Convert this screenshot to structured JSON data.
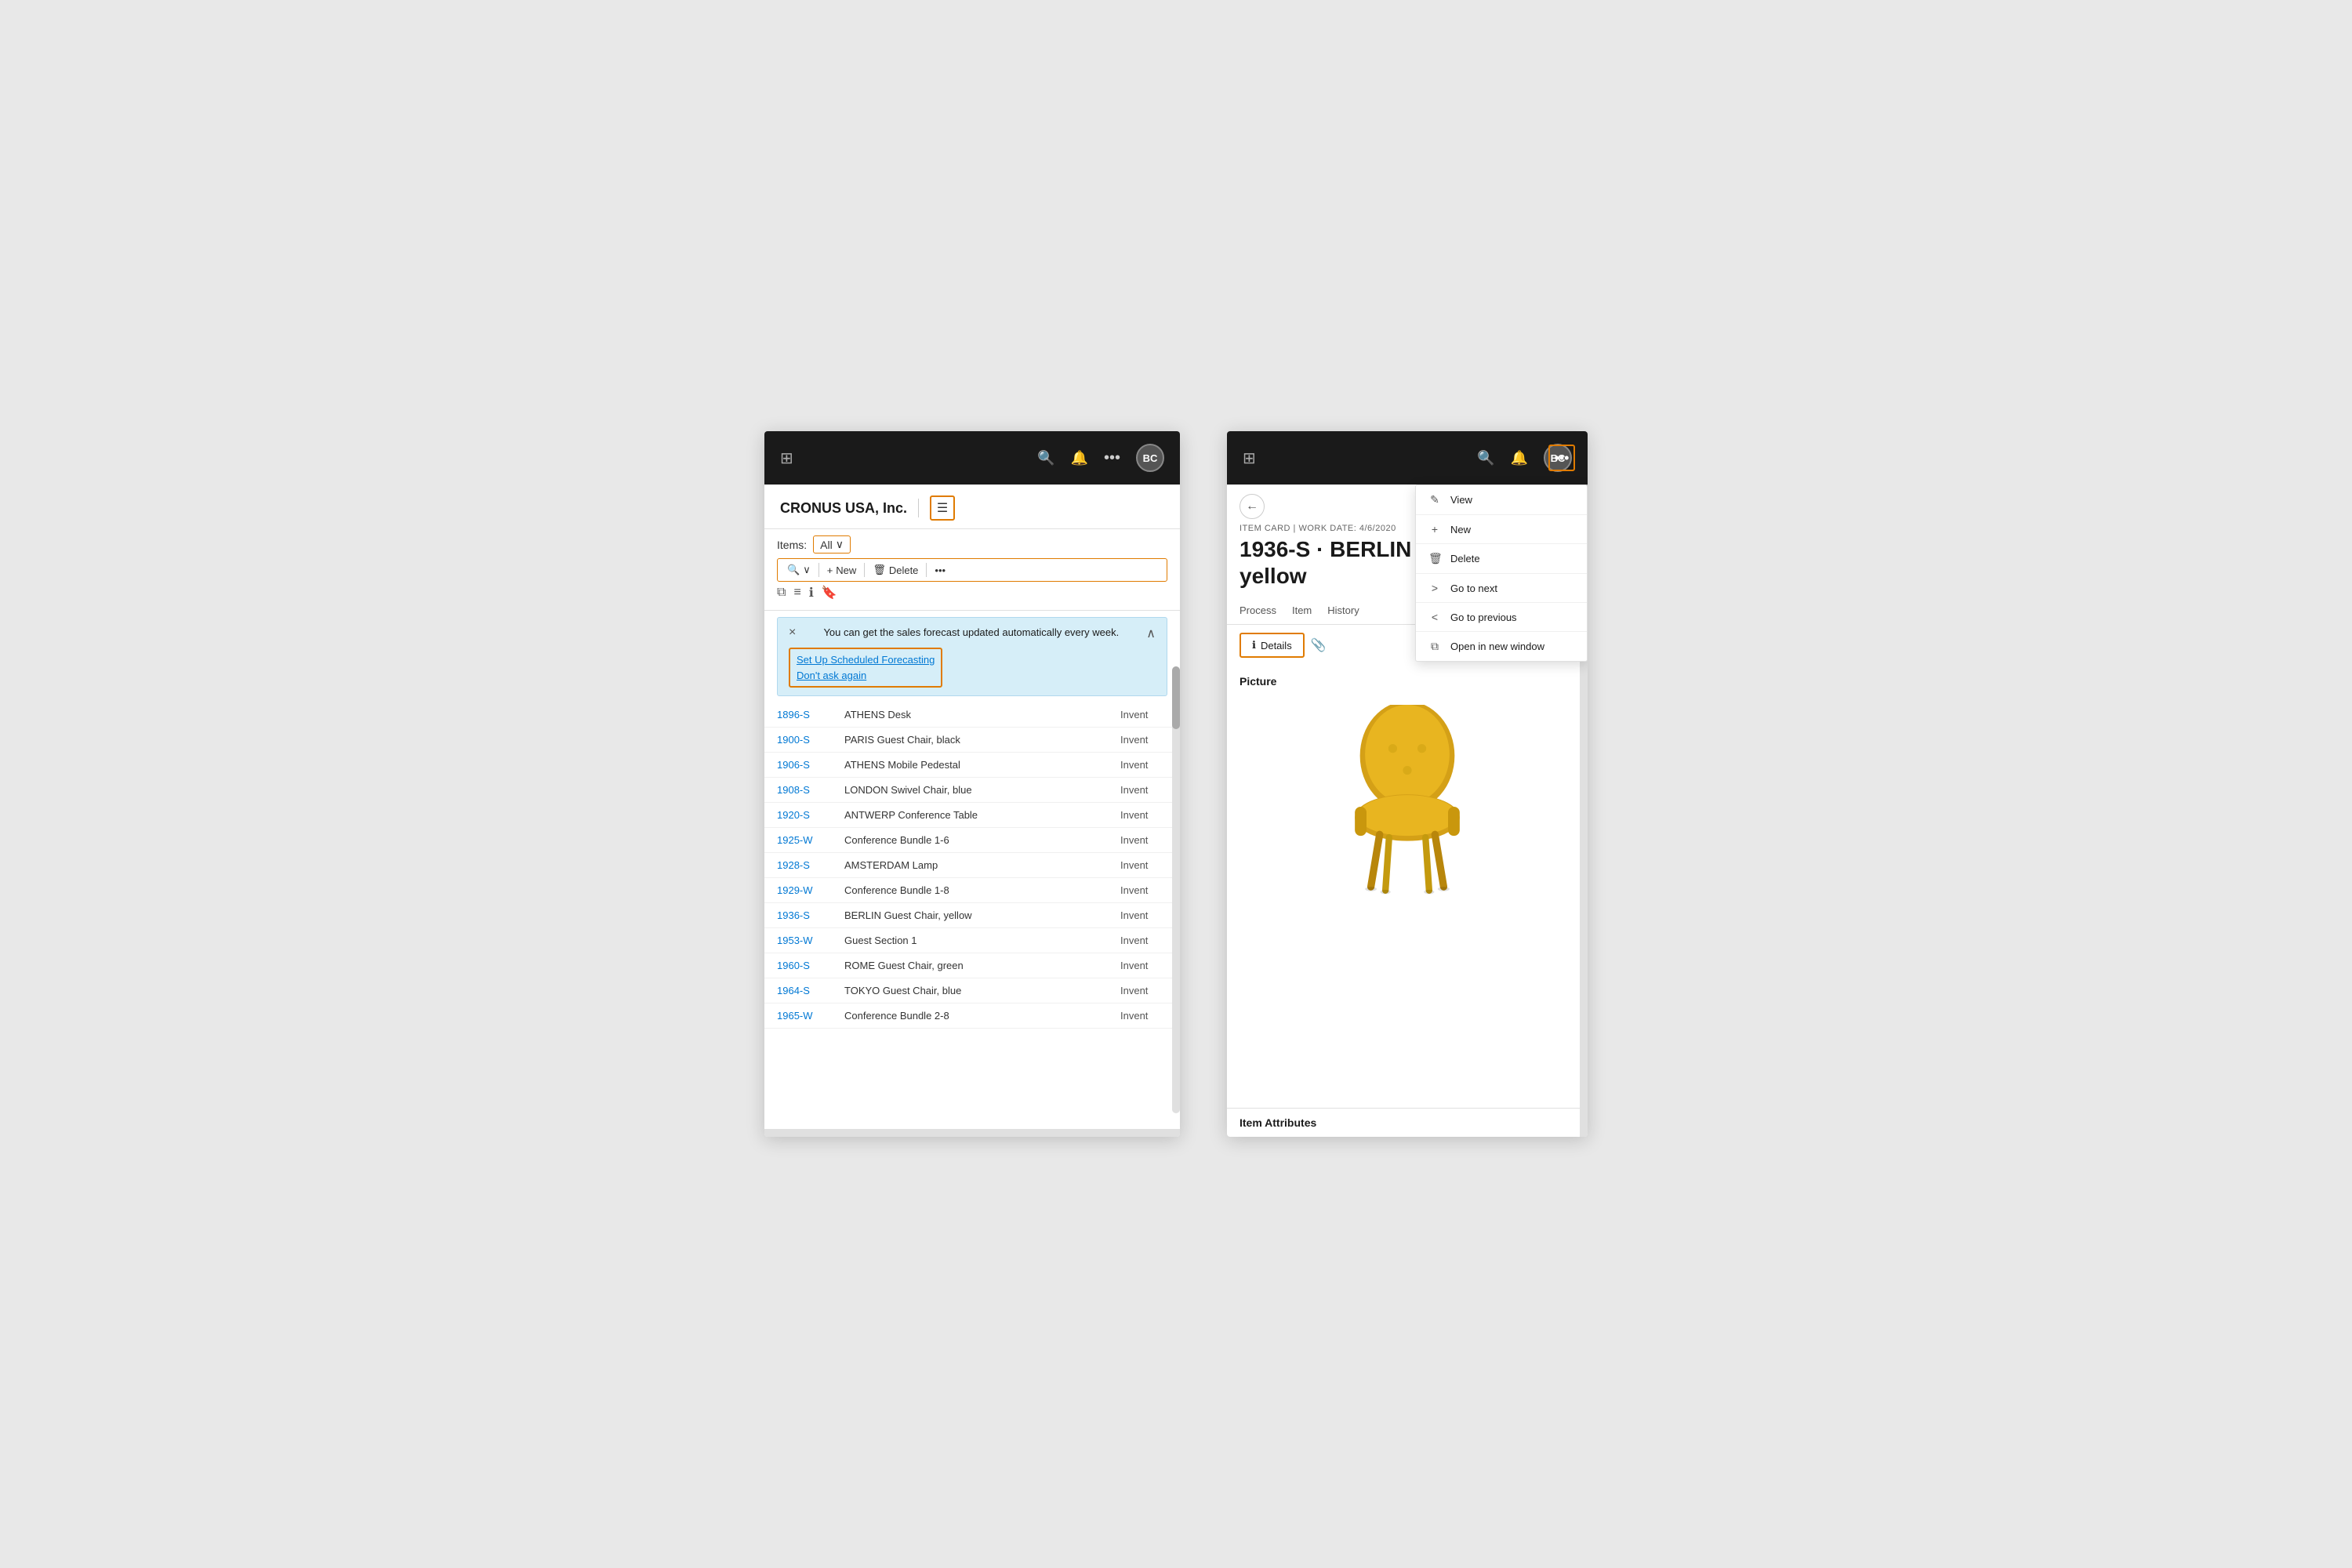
{
  "left": {
    "navBar": {
      "gridIcon": "⊞",
      "searchIcon": "🔍",
      "bellIcon": "🔔",
      "dotsIcon": "•••",
      "avatarText": "BC"
    },
    "companyName": "CRONUS USA, Inc.",
    "menuIcon": "☰",
    "items": {
      "label": "Items:",
      "filter": "All",
      "filterChevron": "∨"
    },
    "toolbar": {
      "searchIcon": "🔍",
      "chevron": "∨",
      "newLabel": "New",
      "newIcon": "+",
      "deleteLabel": "Delete",
      "deleteIcon": "🗑",
      "moreIcon": "•••",
      "filterIcon": "⧉",
      "listIcon": "≡",
      "infoIcon": "ℹ",
      "bookmarkIcon": "🔖"
    },
    "banner": {
      "closeIcon": "×",
      "collapseIcon": "∧",
      "text": "You can get the sales forecast updated automatically every week.",
      "link1": "Set Up Scheduled Forecasting",
      "link2": "Don't ask again"
    },
    "rows": [
      {
        "id": "1896-S",
        "name": "ATHENS Desk",
        "type": "Invent"
      },
      {
        "id": "1900-S",
        "name": "PARIS Guest Chair, black",
        "type": "Invent"
      },
      {
        "id": "1906-S",
        "name": "ATHENS Mobile Pedestal",
        "type": "Invent"
      },
      {
        "id": "1908-S",
        "name": "LONDON Swivel Chair, blue",
        "type": "Invent"
      },
      {
        "id": "1920-S",
        "name": "ANTWERP Conference Table",
        "type": "Invent"
      },
      {
        "id": "1925-W",
        "name": "Conference Bundle 1-6",
        "type": "Invent"
      },
      {
        "id": "1928-S",
        "name": "AMSTERDAM Lamp",
        "type": "Invent"
      },
      {
        "id": "1929-W",
        "name": "Conference Bundle 1-8",
        "type": "Invent"
      },
      {
        "id": "1936-S",
        "name": "BERLIN Guest Chair, yellow",
        "type": "Invent"
      },
      {
        "id": "1953-W",
        "name": "Guest Section 1",
        "type": "Invent"
      },
      {
        "id": "1960-S",
        "name": "ROME Guest Chair, green",
        "type": "Invent"
      },
      {
        "id": "1964-S",
        "name": "TOKYO Guest Chair, blue",
        "type": "Invent"
      },
      {
        "id": "1965-W",
        "name": "Conference Bundle 2-8",
        "type": "Invent"
      }
    ]
  },
  "right": {
    "navBar": {
      "gridIcon": "⊞",
      "searchIcon": "🔍",
      "bellIcon": "🔔",
      "dotsIcon": "•••",
      "avatarText": "BC"
    },
    "breadcrumb": "ITEM CARD | WORK DATE: 4/6/2020",
    "title": "1936-S · BERLIN Guest Chair, yellow",
    "backIcon": "←",
    "tabs": [
      {
        "label": "Process",
        "active": false
      },
      {
        "label": "Item",
        "active": false
      },
      {
        "label": "History",
        "active": false
      }
    ],
    "detailsLabel": "Details",
    "infoIcon": "ℹ",
    "attachIcon": "📎",
    "pictureLabel": "Picture",
    "itemAttributesLabel": "Item Attributes",
    "moreIcon": "•••",
    "moreIconCard": "•••",
    "dropdown": {
      "items": [
        {
          "icon": "✎",
          "label": "View"
        },
        {
          "icon": "+",
          "label": "New"
        },
        {
          "icon": "🗑",
          "label": "Delete"
        },
        {
          "icon": ">",
          "label": "Go to next"
        },
        {
          "icon": "<",
          "label": "Go to previous"
        },
        {
          "icon": "⧉",
          "label": "Open in new window"
        }
      ]
    }
  }
}
